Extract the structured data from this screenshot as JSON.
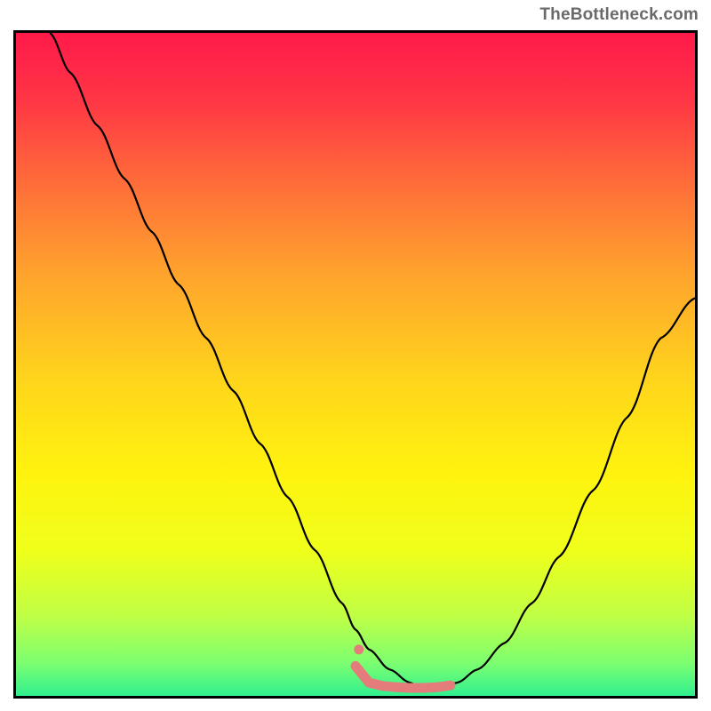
{
  "attribution": "TheBottleneck.com",
  "chart_data": {
    "type": "line",
    "title": "",
    "xlabel": "",
    "ylabel": "",
    "xlim": [
      0,
      100
    ],
    "ylim": [
      0,
      100
    ],
    "grid": false,
    "legend": false,
    "background_gradient_stops": [
      {
        "offset": 0.0,
        "color": "#ff1a4a"
      },
      {
        "offset": 0.1,
        "color": "#ff3545"
      },
      {
        "offset": 0.22,
        "color": "#ff6a3a"
      },
      {
        "offset": 0.36,
        "color": "#ffa22d"
      },
      {
        "offset": 0.52,
        "color": "#ffd41c"
      },
      {
        "offset": 0.66,
        "color": "#fff20f"
      },
      {
        "offset": 0.78,
        "color": "#f0ff1a"
      },
      {
        "offset": 0.88,
        "color": "#bfff45"
      },
      {
        "offset": 0.95,
        "color": "#7dff70"
      },
      {
        "offset": 1.0,
        "color": "#30f090"
      }
    ],
    "series": [
      {
        "name": "bottleneck-curve",
        "color": "#000000",
        "x": [
          5,
          8,
          12,
          16,
          20,
          24,
          28,
          32,
          36,
          40,
          44,
          48,
          50,
          52,
          55,
          58,
          60,
          62,
          65,
          68,
          72,
          76,
          80,
          85,
          90,
          95,
          100
        ],
        "y": [
          100,
          94,
          86,
          78,
          70,
          62,
          54,
          46,
          38,
          30,
          22,
          14,
          10,
          7,
          4,
          2,
          1,
          1,
          2,
          4,
          8,
          14,
          21,
          31,
          42,
          54,
          60
        ]
      },
      {
        "name": "optimal-band",
        "type": "scatter",
        "color": "#e47c7c",
        "x": [
          50,
          52,
          54,
          56,
          58,
          60,
          62,
          64
        ],
        "y": [
          4.5,
          2,
          1.5,
          1.3,
          1.2,
          1.2,
          1.3,
          1.6
        ]
      },
      {
        "name": "optimal-band-end-dot",
        "type": "scatter",
        "color": "#e47c7c",
        "x": [
          50.5
        ],
        "y": [
          7
        ]
      }
    ]
  }
}
